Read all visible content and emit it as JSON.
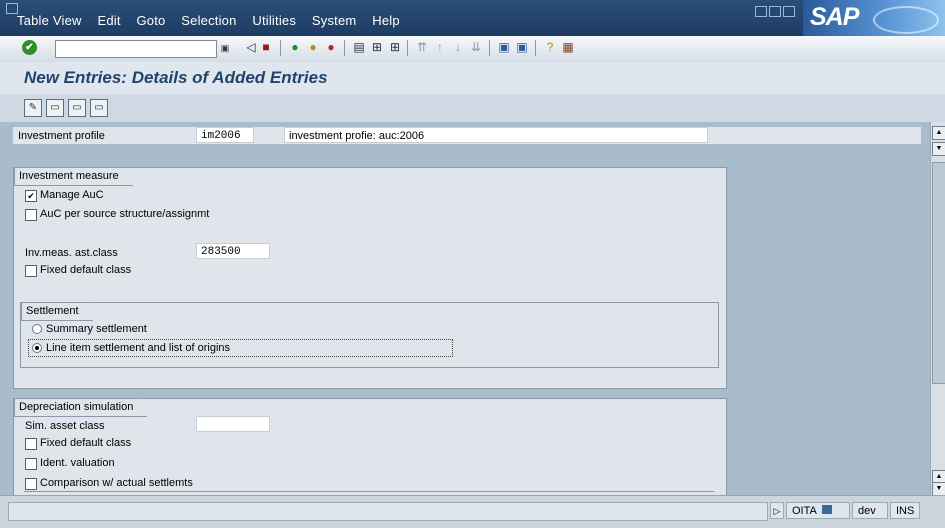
{
  "menu": [
    "Table View",
    "Edit",
    "Goto",
    "Selection",
    "Utilities",
    "System",
    "Help"
  ],
  "brand": "SAP",
  "screen_title": "New Entries: Details of Added Entries",
  "investment_profile": {
    "label": "Investment profile",
    "value": "im2006",
    "description": "investment profie: auc:2006"
  },
  "investment_measure": {
    "title": "Investment measure",
    "manage_auc": {
      "label": "Manage AuC",
      "checked": true
    },
    "auc_per_source": {
      "label": "AuC per source structure/assignmt",
      "checked": false
    },
    "asset_class_label": "Inv.meas. ast.class",
    "asset_class_value": "283500",
    "fixed_default_class": {
      "label": "Fixed default class",
      "checked": false
    },
    "settlement": {
      "title": "Settlement",
      "summary": "Summary settlement",
      "line_item": "Line item settlement and list of origins",
      "selected": "line_item"
    }
  },
  "depreciation_simulation": {
    "title": "Depreciation simulation",
    "sim_asset_class_label": "Sim. asset class",
    "sim_asset_class_value": "",
    "fixed_default_class": "Fixed default class",
    "ident_valuation": "Ident. valuation",
    "comparison": "Comparison w/ actual settlemts"
  },
  "status_bar": {
    "system": "OITA",
    "client": "dev",
    "mode": "INS"
  },
  "icons": {
    "check": "check-icon",
    "save": "save-icon",
    "back": "back-icon",
    "exit": "exit-icon",
    "cancel": "cancel-icon",
    "print": "print-icon",
    "find": "find-icon",
    "help": "help-icon"
  }
}
